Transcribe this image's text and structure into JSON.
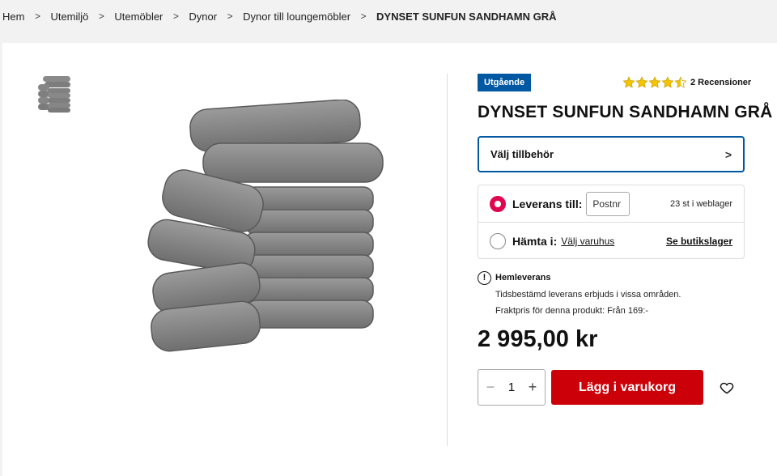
{
  "breadcrumb": [
    {
      "label": "Hem"
    },
    {
      "label": "Utemiljö"
    },
    {
      "label": "Utemöbler"
    },
    {
      "label": "Dynor"
    },
    {
      "label": "Dynor till loungemöbler"
    },
    {
      "label": "DYNSET SUNFUN SANDHAMN GRÅ"
    }
  ],
  "product": {
    "badge": "Utgående",
    "rating": 4.5,
    "reviews_label": "2 Recensioner",
    "title": "DYNSET SUNFUN SANDHAMN GRÅ",
    "accessories_label": "Välj tillbehör",
    "price": "2 995,00 kr",
    "quantity": "1",
    "add_to_cart_label": "Lägg i varukorg"
  },
  "delivery": {
    "delivery_label": "Leverans till:",
    "postnr_placeholder": "Postnr",
    "stock_text": "23 st i weblager",
    "pickup_label": "Hämta i:",
    "choose_store_link": "Välj varuhus",
    "see_stock_link": "Se butikslager"
  },
  "info": {
    "title": "Hemleverans",
    "line1": "Tidsbestämd leverans erbjuds i vissa områden.",
    "line2": "Fraktpris för denna produkt: Från 169:-"
  },
  "colors": {
    "badge_blue": "#0058a3",
    "cart_red": "#cc0008",
    "radio_red": "#e00751",
    "star_yellow": "#f5c400"
  },
  "icons": [
    "chevron-right-icon",
    "star-icon",
    "info-icon",
    "minus-icon",
    "plus-icon",
    "heart-icon"
  ]
}
